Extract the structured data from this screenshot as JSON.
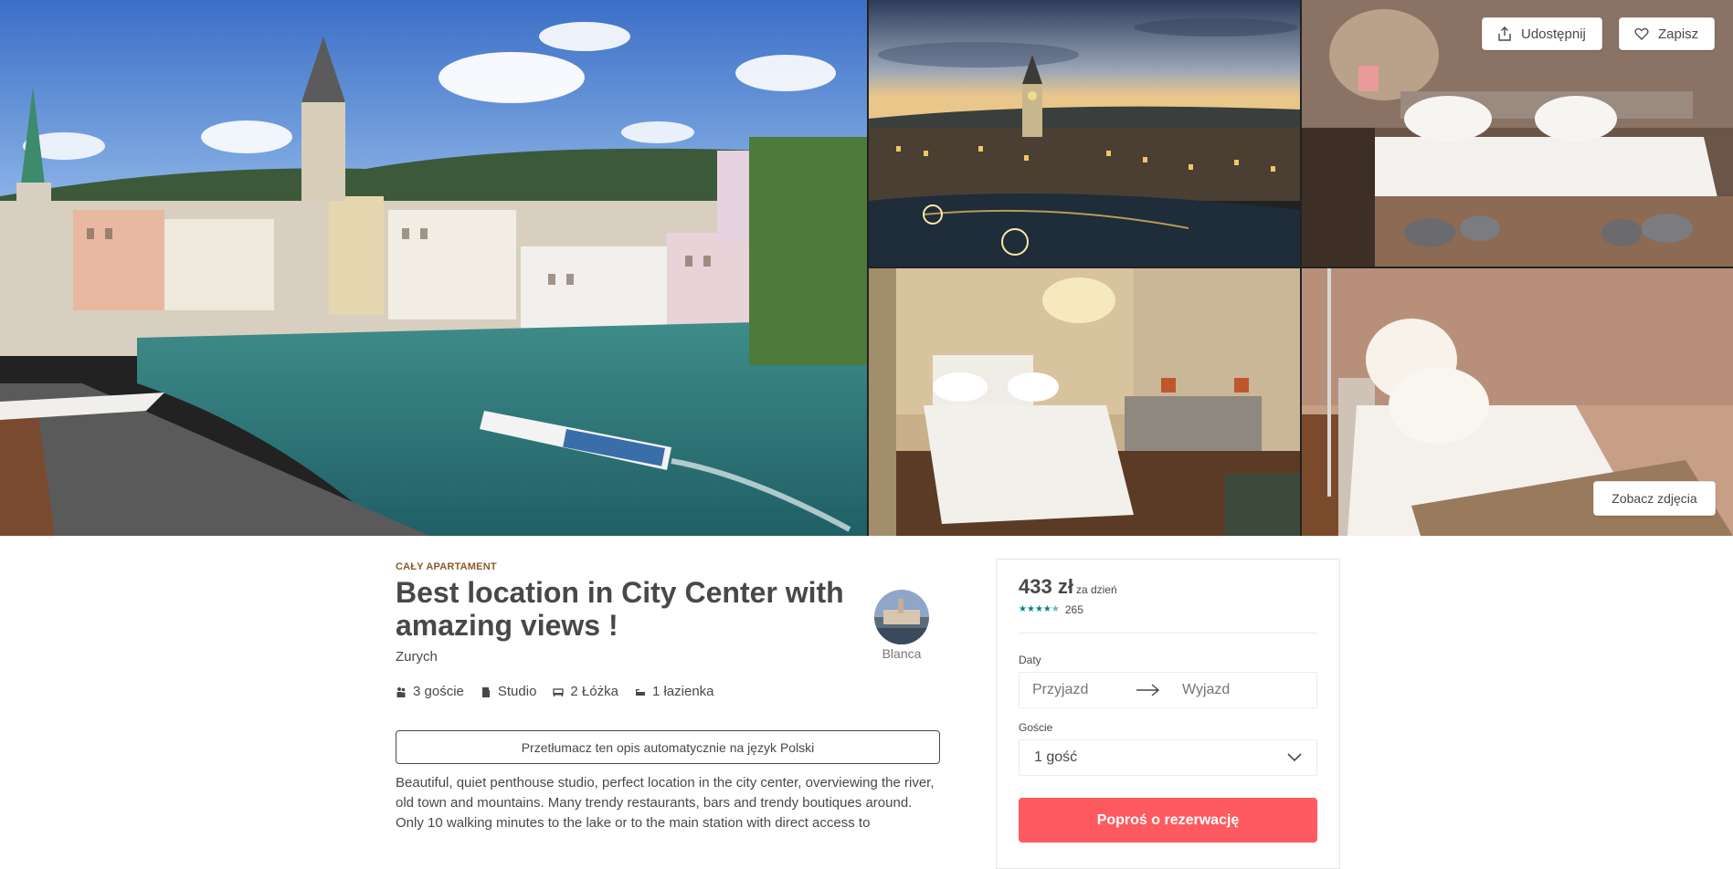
{
  "gallery": {
    "share_label": "Udostępnij",
    "save_label": "Zapisz",
    "view_photos_label": "Zobacz zdjęcia"
  },
  "listing": {
    "kicker": "CAŁY APARTAMENT",
    "title": "Best location in City Center with amazing views !",
    "city": "Zurych",
    "host_name": "Blanca",
    "amenities": [
      {
        "icon": "guests-icon",
        "label": "3 goście"
      },
      {
        "icon": "studio-icon",
        "label": "Studio"
      },
      {
        "icon": "bed-icon",
        "label": "2 Łóżka"
      },
      {
        "icon": "bath-icon",
        "label": "1 łazienka"
      }
    ],
    "translate_label": "Przetłumacz ten opis automatycznie na język Polski",
    "description": [
      "Beautiful, quiet penthouse studio, perfect location in the city center, overviewing the river, old town and mountains. Many trendy restaurants, bars and trendy boutiques around.",
      "Only 10 walking minutes to the lake or to the main station with direct access to"
    ]
  },
  "booking": {
    "price": "433 zł",
    "per_label": "za dzień",
    "rating_stars": 4.5,
    "reviews_count": "265",
    "dates_label": "Daty",
    "checkin_placeholder": "Przyjazd",
    "checkout_placeholder": "Wyjazd",
    "guests_label": "Goście",
    "guests_value": "1 gość",
    "reserve_label": "Poproś o rezerwację"
  },
  "colors": {
    "accent": "#ff5a5f",
    "rating": "#008489",
    "kicker": "#8b5a2b",
    "text": "#484848"
  }
}
